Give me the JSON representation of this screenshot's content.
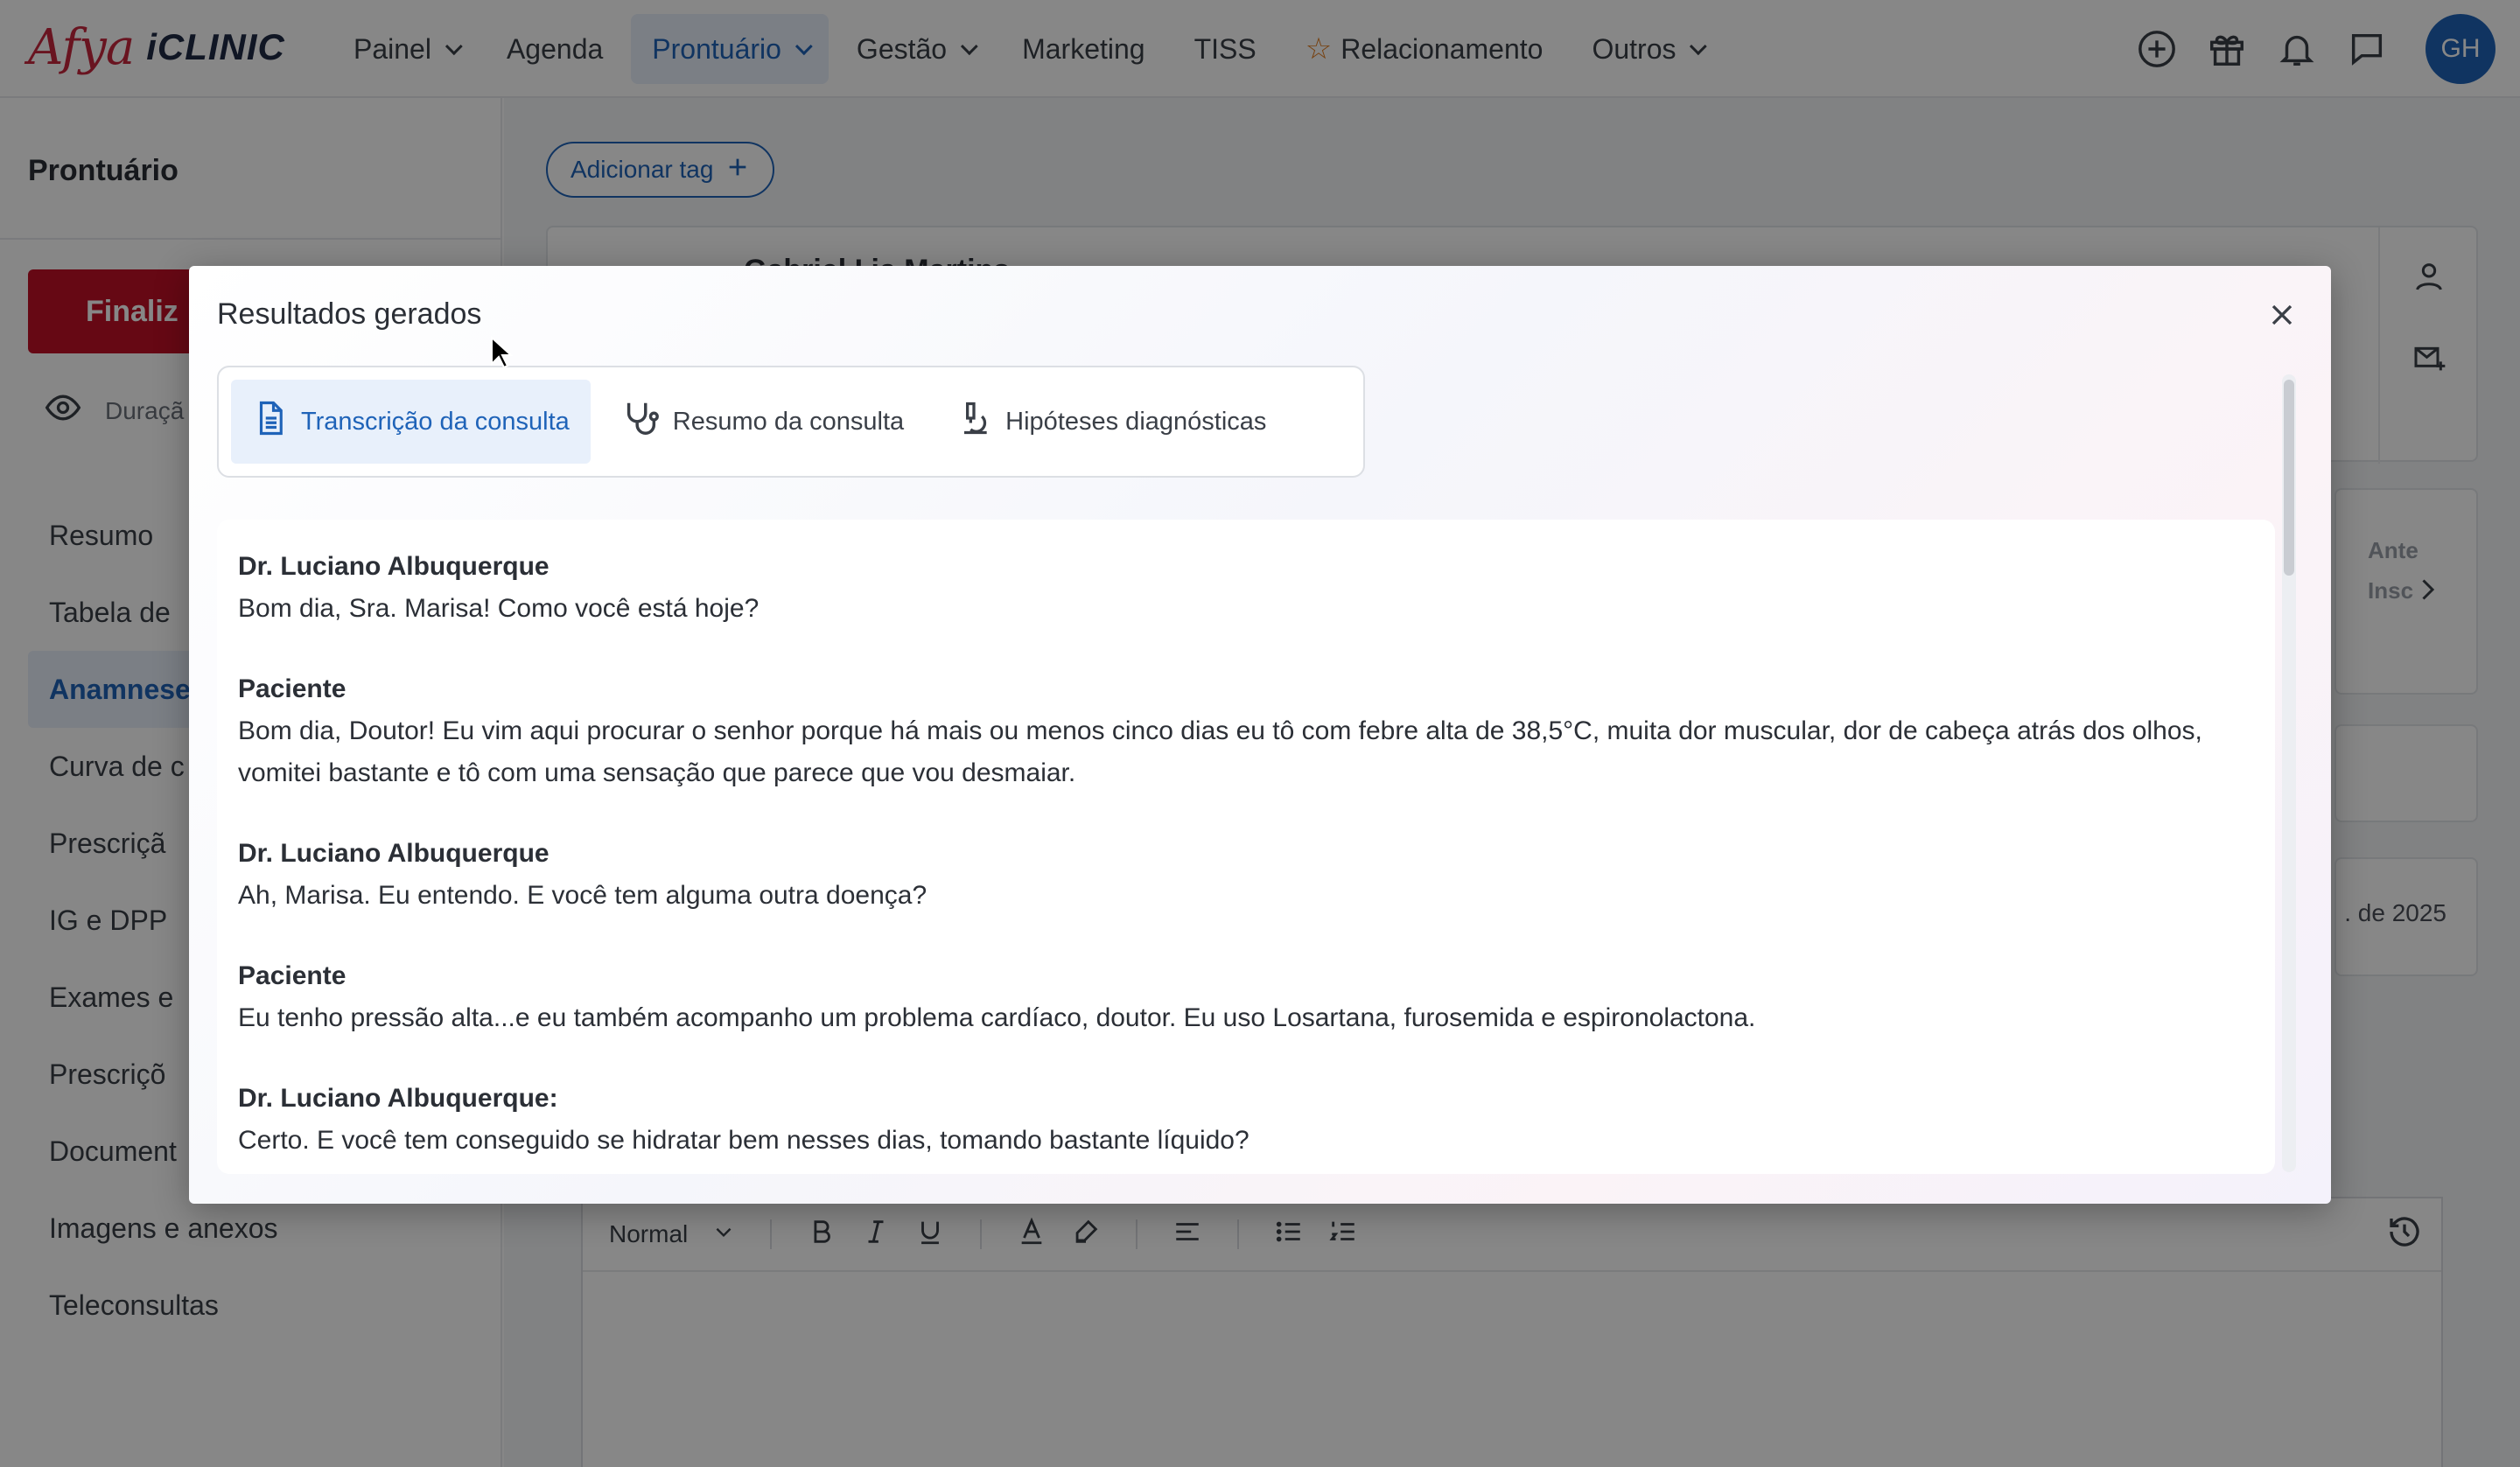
{
  "brand": {
    "afya": "Afya",
    "iclinic": "iCLINIC",
    "accent": "#c6263e"
  },
  "nav": {
    "items": [
      {
        "label": "Painel",
        "dropdown": true
      },
      {
        "label": "Agenda",
        "dropdown": false
      },
      {
        "label": "Prontuário",
        "dropdown": true,
        "active": true
      },
      {
        "label": "Gestão",
        "dropdown": true
      },
      {
        "label": "Marketing",
        "dropdown": false
      },
      {
        "label": "TISS",
        "dropdown": false
      },
      {
        "label": "Relacionamento",
        "dropdown": false,
        "icon": "star-icon"
      },
      {
        "label": "Outros",
        "dropdown": true
      }
    ],
    "icons": [
      "add-circle-icon",
      "gift-icon",
      "bell-icon",
      "chat-icon"
    ],
    "avatar_initials": "GH"
  },
  "sidebar": {
    "title": "Prontuário",
    "finalize_label": "Finaliz",
    "duration_label": "Duraçã",
    "items": [
      {
        "label": "Resumo"
      },
      {
        "label": "Tabela de"
      },
      {
        "label": "Anamnese",
        "active": true
      },
      {
        "label": "Curva de c"
      },
      {
        "label": "Prescriçã"
      },
      {
        "label": "IG e DPP"
      },
      {
        "label": "Exames e"
      },
      {
        "label": "Prescriçõ"
      },
      {
        "label": "Document"
      },
      {
        "label": "Imagens e anexos"
      },
      {
        "label": "Teleconsultas"
      }
    ]
  },
  "main": {
    "add_tag_label": "Adicionar tag",
    "patient_name_fragment": "Gabriel I ia Martins",
    "tab_fragment_1": "Ante",
    "tab_fragment_2": "Insc",
    "date_fragment": ". de 2025",
    "editor": {
      "style_select": "Normal"
    }
  },
  "modal": {
    "title": "Resultados gerados",
    "tabs": [
      {
        "label": "Transcrição da consulta",
        "icon": "document-icon",
        "active": true
      },
      {
        "label": "Resumo da consulta",
        "icon": "stethoscope-icon",
        "active": false
      },
      {
        "label": "Hipóteses diagnósticas",
        "icon": "microscope-icon",
        "active": false
      }
    ],
    "transcript": [
      {
        "speaker": "Dr. Luciano Albuquerque",
        "text": "Bom dia, Sra. Marisa! Como você está hoje?"
      },
      {
        "speaker": "Paciente",
        "text": "Bom dia, Doutor! Eu vim aqui procurar o senhor porque há mais ou menos cinco dias eu tô com febre alta de 38,5°C, muita dor muscular, dor de cabeça atrás dos olhos, vomitei bastante e tô com uma sensação que parece que vou desmaiar."
      },
      {
        "speaker": "Dr. Luciano Albuquerque",
        "text": "Ah, Marisa. Eu entendo. E você tem alguma outra doença?"
      },
      {
        "speaker": "Paciente",
        "text": "Eu tenho pressão alta...e eu também acompanho um problema cardíaco, doutor. Eu uso Losartana, furosemida e espironolactona."
      },
      {
        "speaker": "Dr. Luciano Albuquerque:",
        "text": "Certo. E você tem conseguido se hidratar bem nesses dias, tomando bastante líquido?"
      }
    ]
  }
}
